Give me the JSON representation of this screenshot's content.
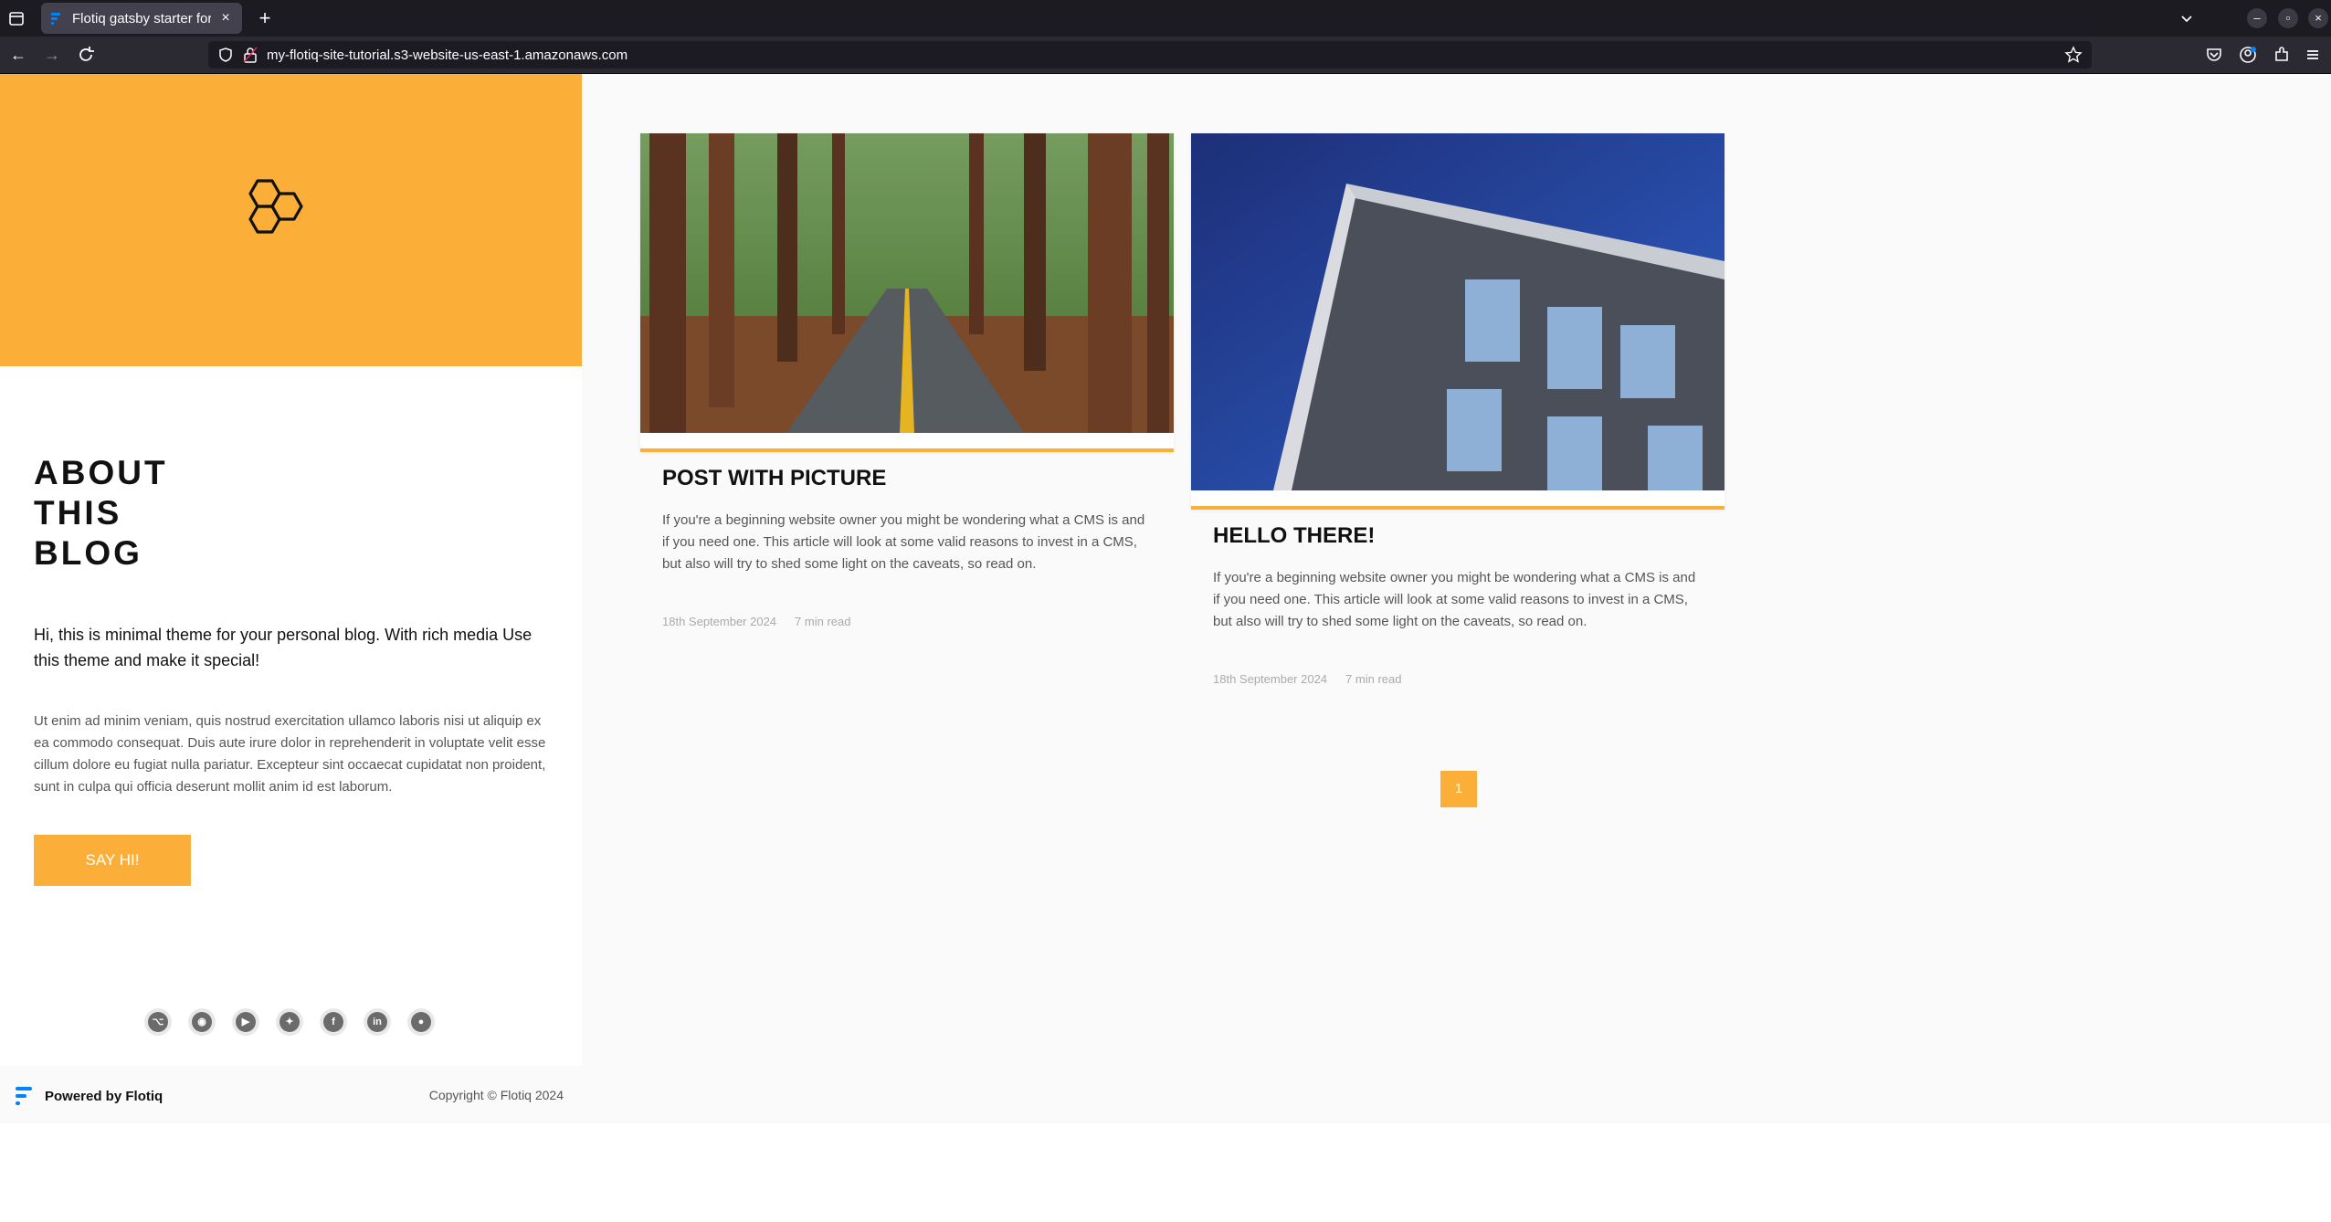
{
  "browser": {
    "tab_title": "Flotiq gatsby starter for b",
    "tab_close": "×",
    "newtab_label": "+",
    "url": "my-flotiq-site-tutorial.s3-website-us-east-1.amazonaws.com"
  },
  "sidebar": {
    "about_title_lines": [
      "ABOUT",
      "THIS",
      "BLOG"
    ],
    "intro": "Hi, this is minimal theme for your personal blog. With rich media Use this theme and make it special!",
    "lorem": "Ut enim ad minim veniam, quis nostrud exercitation ullamco laboris nisi ut aliquip ex ea commodo consequat. Duis aute irure dolor in reprehenderit in voluptate velit esse cillum dolore eu fugiat nulla pariatur. Excepteur sint occaecat cupidatat non proident, sunt in culpa qui officia deserunt mollit anim id est laborum.",
    "button_label": "SAY HI!",
    "socials": [
      "github-icon",
      "discord-icon",
      "youtube-icon",
      "twitter-icon",
      "facebook-icon",
      "linkedin-icon",
      "reddit-icon"
    ]
  },
  "footer": {
    "powered_by": "Powered by Flotiq",
    "copyright": "Copyright © Flotiq 2024"
  },
  "posts": [
    {
      "title": "POST WITH PICTURE",
      "excerpt": "If you're a beginning website owner you might be wondering what a CMS is and if you need one. This article will look at some valid reasons to invest in a CMS, but also will try to shed some light on the caveats, so read on.",
      "date": "18th September 2024",
      "read_time": "7 min read",
      "image": "forest-road-photo"
    },
    {
      "title": "HELLO THERE!",
      "excerpt": "If you're a beginning website owner you might be wondering what a CMS is and if you need one. This article will look at some valid reasons to invest in a CMS, but also will try to shed some light on the caveats, so read on.",
      "date": "18th September 2024",
      "read_time": "7 min read",
      "image": "building-photo"
    }
  ],
  "pagination": {
    "current_page": "1"
  },
  "colors": {
    "accent": "#fbae38",
    "chrome_dark": "#1c1b22",
    "chrome_toolbar": "#2b2a33"
  }
}
